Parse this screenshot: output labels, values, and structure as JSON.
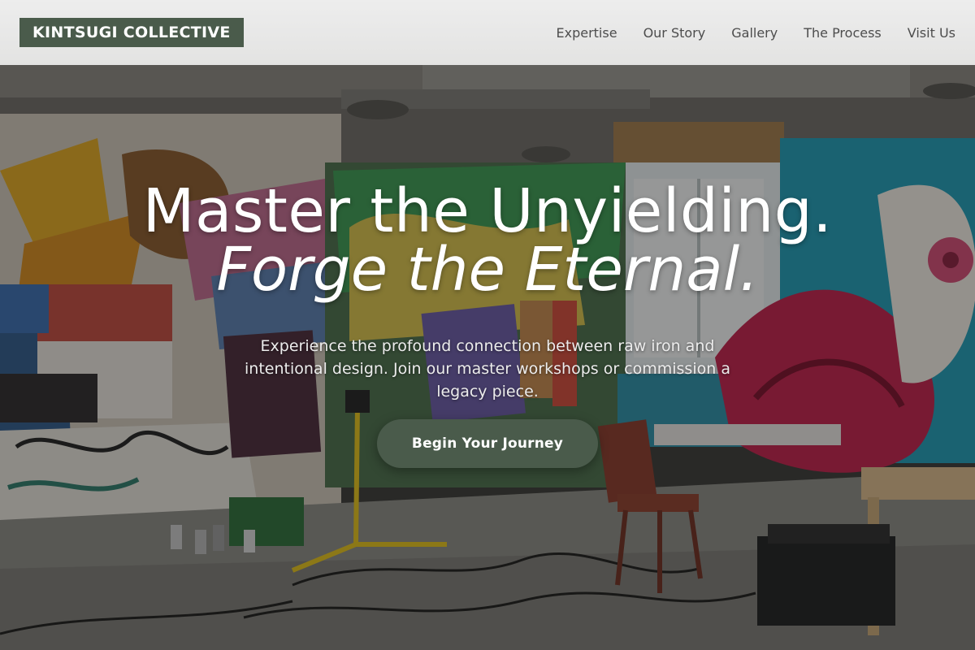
{
  "header": {
    "logo": "KINTSUGI COLLECTIVE",
    "nav": [
      {
        "label": "Expertise"
      },
      {
        "label": "Our Story"
      },
      {
        "label": "Gallery"
      },
      {
        "label": "The Process"
      },
      {
        "label": "Visit Us"
      }
    ]
  },
  "hero": {
    "headline_line1": "Master the Unyielding.",
    "headline_line2": "Forge the Eternal.",
    "subtext": "Experience the profound connection between raw iron and intentional design. Join our master workshops or commission a legacy piece.",
    "cta_label": "Begin Your Journey",
    "background": "graffiti art studio interior with easels, chairs, paint cans and work lights"
  },
  "colors": {
    "brand_green": "#4a5b4b",
    "header_bg": "#e8e8e7",
    "nav_text": "#4d4d4d",
    "hero_text": "#ffffff"
  }
}
